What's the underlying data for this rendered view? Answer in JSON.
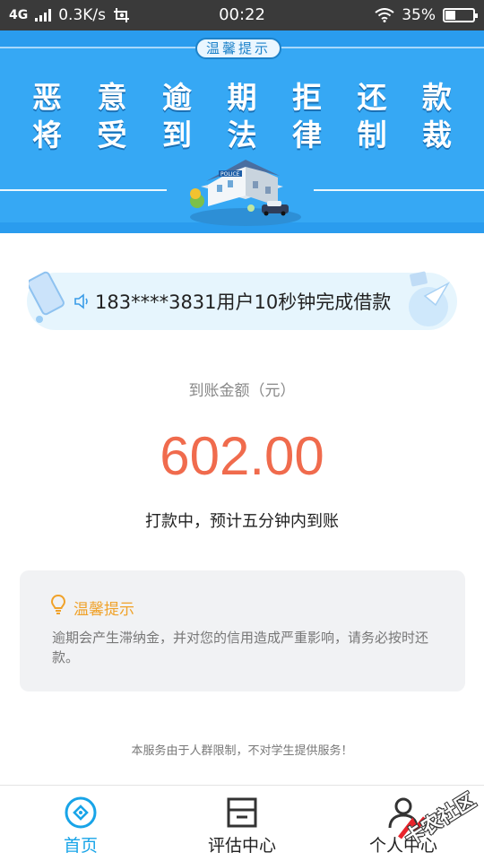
{
  "status_bar": {
    "network": "4G",
    "speed": "0.3K/s",
    "time": "00:22",
    "battery_text": "35%",
    "battery_level": 0.35
  },
  "banner": {
    "badge": "温馨提示",
    "line1": "恶意逾期拒还款",
    "line2": "将受到法律制裁",
    "building_sign": "POLICE"
  },
  "notice": {
    "text": "183****3831用户10秒钟完成借款"
  },
  "payout": {
    "label": "到账金额（元）",
    "amount": "602.00",
    "status": "打款中，预计五分钟内到账"
  },
  "tip": {
    "title": "温馨提示",
    "body": "逾期会产生滞纳金，并对您的信用造成严重影响，请务必按时还款。"
  },
  "footer_note": "本服务由于人群限制，不对学生提供服务！",
  "tabs": [
    {
      "label": "首页",
      "icon": "home-icon",
      "active": true
    },
    {
      "label": "评估中心",
      "icon": "assessment-icon",
      "active": false
    },
    {
      "label": "个人中心",
      "icon": "user-icon",
      "active": false
    }
  ],
  "watermark": "卡农社区",
  "colors": {
    "accent": "#18a4e8",
    "banner": "#36a8f4",
    "amount": "#f06b4d",
    "tip_title": "#f0a22a"
  }
}
